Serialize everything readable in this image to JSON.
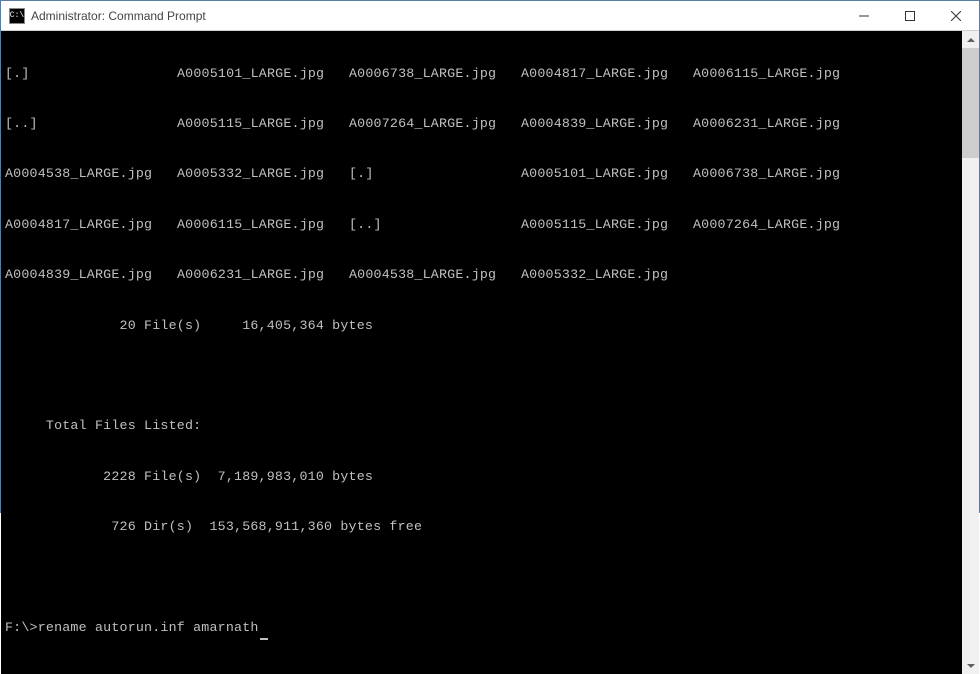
{
  "window": {
    "title": "Administrator: Command Prompt"
  },
  "listing": {
    "rows": [
      [
        "[.]",
        "A0005101_LARGE.jpg",
        "A0006738_LARGE.jpg",
        "A0004817_LARGE.jpg",
        "A0006115_LARGE.jpg"
      ],
      [
        "[..]",
        "A0005115_LARGE.jpg",
        "A0007264_LARGE.jpg",
        "A0004839_LARGE.jpg",
        "A0006231_LARGE.jpg"
      ],
      [
        "A0004538_LARGE.jpg",
        "A0005332_LARGE.jpg",
        "[.]",
        "A0005101_LARGE.jpg",
        "A0006738_LARGE.jpg"
      ],
      [
        "A0004817_LARGE.jpg",
        "A0006115_LARGE.jpg",
        "[..]",
        "A0005115_LARGE.jpg",
        "A0007264_LARGE.jpg"
      ],
      [
        "A0004839_LARGE.jpg",
        "A0006231_LARGE.jpg",
        "A0004538_LARGE.jpg",
        "A0005332_LARGE.jpg",
        ""
      ]
    ],
    "summary_dir": "              20 File(s)     16,405,364 bytes",
    "total_header": "     Total Files Listed:",
    "total_files": "            2228 File(s)  7,189,983,010 bytes",
    "total_dirs": "             726 Dir(s)  153,568,911,360 bytes free"
  },
  "prompt": {
    "path": "F:\\>",
    "command": "rename autorun.inf amarnath"
  }
}
